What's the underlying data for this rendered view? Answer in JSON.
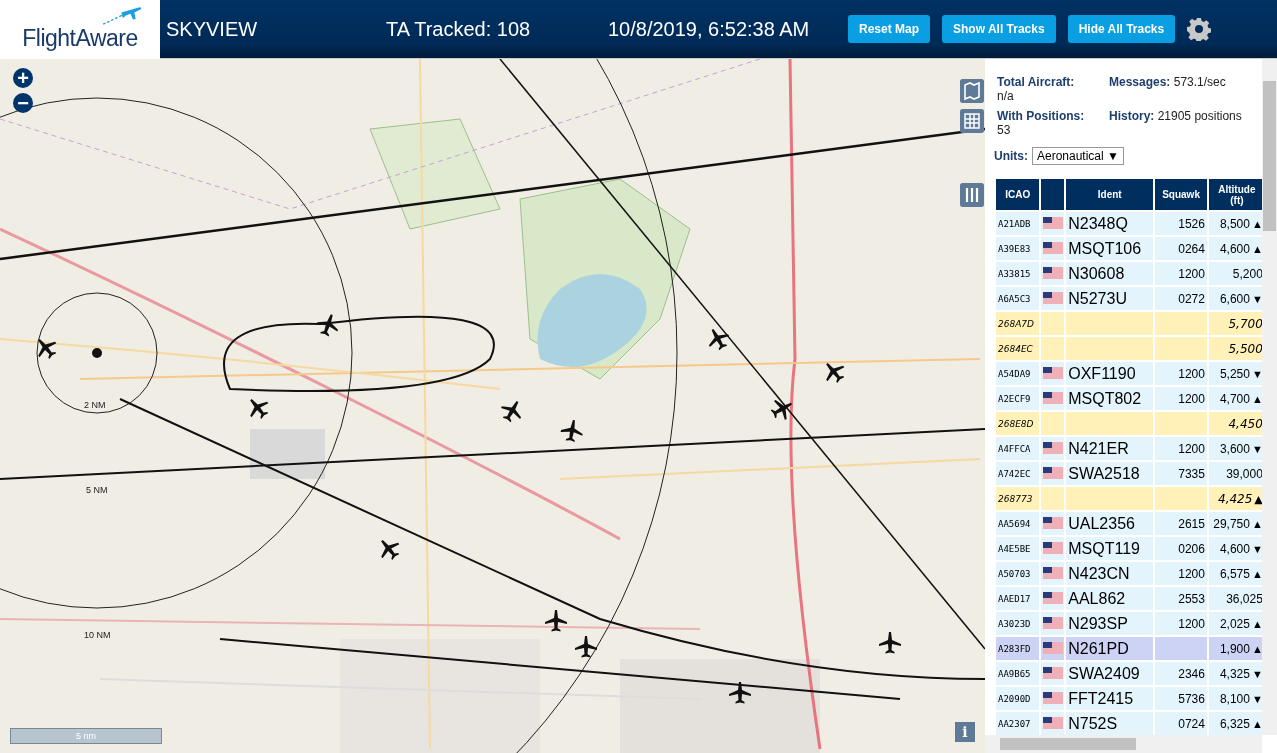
{
  "header": {
    "logo": "FlightAware",
    "title": "SKYVIEW",
    "tracked": "TA Tracked: 108",
    "datetime": "10/8/2019, 6:52:38 AM",
    "buttons": [
      "Reset Map",
      "Show All Tracks",
      "Hide All Tracks"
    ]
  },
  "map": {
    "zoom_in": "+",
    "zoom_out": "−",
    "ring_labels": [
      "2 NM",
      "5 NM",
      "10 NM"
    ],
    "scale": "5 nm",
    "info": "i"
  },
  "stats": [
    {
      "label": "Total Aircraft:",
      "value": "n/a"
    },
    {
      "label": "Messages:",
      "value": "573.1/sec"
    },
    {
      "label": "With Positions:",
      "value": "53"
    },
    {
      "label": "History:",
      "value": "21905 positions"
    }
  ],
  "units": {
    "label": "Units:",
    "value": "Aeronautical",
    "caret": "▼"
  },
  "table": {
    "columns": [
      "ICAO",
      "",
      "Ident",
      "Squawk",
      "Altitude (ft)"
    ],
    "rows": [
      {
        "kind": "identified",
        "selected": false,
        "icao": "A21ADB",
        "ident": "N2348Q",
        "squawk": "1526",
        "altitude": "8,500",
        "trend": "▲"
      },
      {
        "kind": "identified",
        "selected": false,
        "icao": "A39E83",
        "ident": "MSQT106",
        "squawk": "0264",
        "altitude": "4,600",
        "trend": "▲"
      },
      {
        "kind": "identified",
        "selected": false,
        "icao": "A33815",
        "ident": "N30608",
        "squawk": "1200",
        "altitude": "5,200"
      },
      {
        "kind": "identified",
        "selected": false,
        "icao": "A6A5C3",
        "ident": "N5273U",
        "squawk": "0272",
        "altitude": "6,600",
        "trend": "▼"
      },
      {
        "kind": "anonymous",
        "selected": false,
        "icao": "268A7D",
        "altitude": "5,700"
      },
      {
        "kind": "anonymous",
        "selected": false,
        "icao": "2684EC",
        "altitude": "5,500"
      },
      {
        "kind": "identified",
        "selected": false,
        "icao": "A54DA9",
        "ident": "OXF1190",
        "squawk": "1200",
        "altitude": "5,250",
        "trend": "▼"
      },
      {
        "kind": "identified",
        "selected": false,
        "icao": "A2ECF9",
        "ident": "MSQT802",
        "squawk": "1200",
        "altitude": "4,700",
        "trend": "▲"
      },
      {
        "kind": "anonymous",
        "selected": false,
        "icao": "268E8D",
        "altitude": "4,450"
      },
      {
        "kind": "identified",
        "selected": false,
        "icao": "A4FFCA",
        "ident": "N421ER",
        "squawk": "1200",
        "altitude": "3,600",
        "trend": "▼"
      },
      {
        "kind": "identified",
        "selected": false,
        "icao": "A742EC",
        "ident": "SWA2518",
        "squawk": "7335",
        "altitude": "39,000"
      },
      {
        "kind": "anonymous",
        "selected": false,
        "icao": "268773",
        "altitude": "4,425",
        "trend": "▲"
      },
      {
        "kind": "identified",
        "selected": false,
        "icao": "AA5694",
        "ident": "UAL2356",
        "squawk": "2615",
        "altitude": "29,750",
        "trend": "▲"
      },
      {
        "kind": "identified",
        "selected": false,
        "icao": "A4E5BE",
        "ident": "MSQT119",
        "squawk": "0206",
        "altitude": "4,600",
        "trend": "▼"
      },
      {
        "kind": "identified",
        "selected": false,
        "icao": "A50703",
        "ident": "N423CN",
        "squawk": "1200",
        "altitude": "6,575",
        "trend": "▲"
      },
      {
        "kind": "identified",
        "selected": false,
        "icao": "AAED17",
        "ident": "AAL862",
        "squawk": "2553",
        "altitude": "36,025"
      },
      {
        "kind": "identified",
        "selected": false,
        "icao": "A3023D",
        "ident": "N293SP",
        "squawk": "1200",
        "altitude": "2,025",
        "trend": "▲"
      },
      {
        "kind": "identified",
        "selected": true,
        "icao": "A283FD",
        "ident": "N261PD",
        "altitude": "1,900",
        "trend": "▲"
      },
      {
        "kind": "identified",
        "selected": false,
        "icao": "AA9B65",
        "ident": "SWA2409",
        "squawk": "2346",
        "altitude": "4,325",
        "trend": "▼"
      },
      {
        "kind": "identified",
        "selected": false,
        "icao": "A2090D",
        "ident": "FFT2415",
        "squawk": "5736",
        "altitude": "8,100",
        "trend": "▼"
      },
      {
        "kind": "identified",
        "selected": false,
        "icao": "AA2307",
        "ident": "N752S",
        "squawk": "0724",
        "altitude": "6,325",
        "trend": "▲"
      }
    ]
  }
}
